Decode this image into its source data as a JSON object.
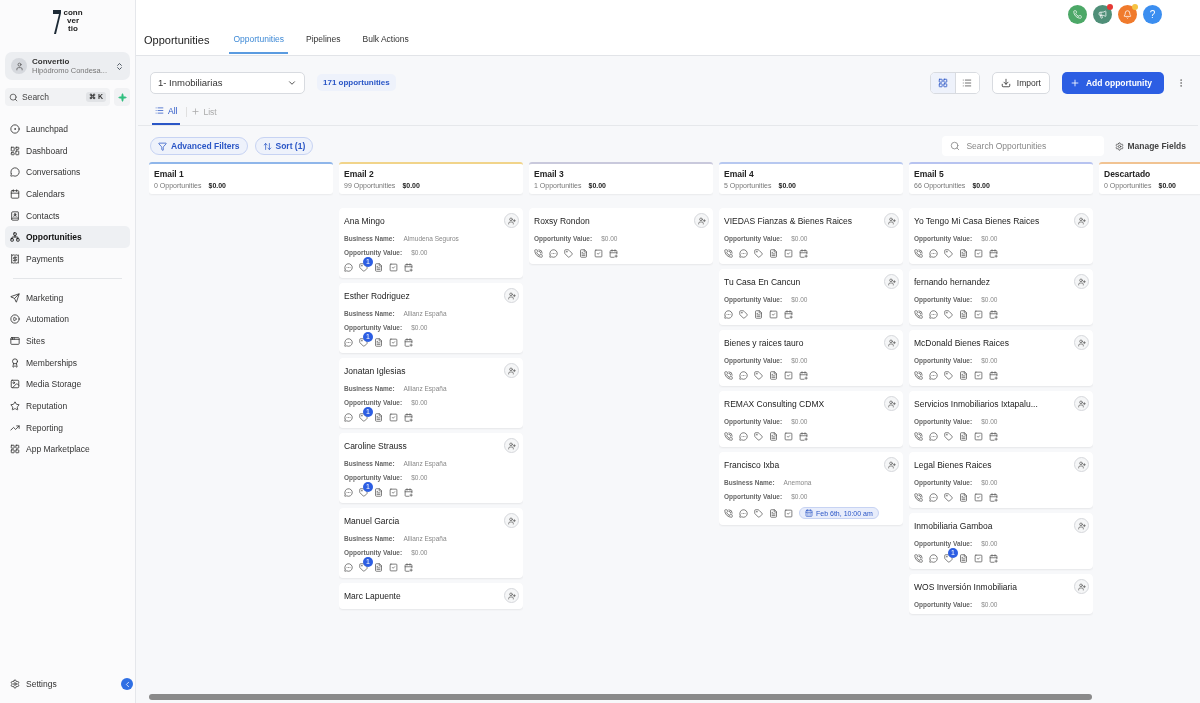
{
  "sidebar": {
    "logo_text": [
      "conn",
      "ver",
      "tio"
    ],
    "account": {
      "name": "Convertio",
      "location": "Hipódromo Condesa..."
    },
    "search": {
      "placeholder": "Search",
      "shortcut": "⌘ K"
    },
    "nav_groups": [
      [
        {
          "label": "Launchpad",
          "selected": false
        },
        {
          "label": "Dashboard",
          "selected": false
        },
        {
          "label": "Conversations",
          "selected": false
        },
        {
          "label": "Calendars",
          "selected": false
        },
        {
          "label": "Contacts",
          "selected": false
        },
        {
          "label": "Opportunities",
          "selected": true
        },
        {
          "label": "Payments",
          "selected": false
        }
      ],
      [
        {
          "label": "Marketing",
          "selected": false
        },
        {
          "label": "Automation",
          "selected": false
        },
        {
          "label": "Sites",
          "selected": false
        },
        {
          "label": "Memberships",
          "selected": false
        },
        {
          "label": "Media Storage",
          "selected": false
        },
        {
          "label": "Reputation",
          "selected": false
        },
        {
          "label": "Reporting",
          "selected": false
        },
        {
          "label": "App Marketplace",
          "selected": false
        }
      ]
    ],
    "settings": "Settings"
  },
  "header": {
    "title": "Opportunities",
    "tabs": [
      {
        "label": "Opportunities",
        "selected": true
      },
      {
        "label": "Pipelines",
        "selected": false
      },
      {
        "label": "Bulk Actions",
        "selected": false
      }
    ],
    "actions": [
      {
        "kind": "phone",
        "color": "#4ca867"
      },
      {
        "kind": "megaphone",
        "color": "#4f8f78",
        "dot": {
          "color": "#e53935"
        }
      },
      {
        "kind": "bell",
        "color": "#f07a2c",
        "dot": {
          "color": "#f5c242"
        }
      },
      {
        "kind": "help",
        "color": "#3b8ef0",
        "label": "?"
      }
    ]
  },
  "toolbar": {
    "pipeline": "1- Inmobiliarias",
    "count": "171 opportunities",
    "views": [
      {
        "kind": "grid",
        "selected": true
      },
      {
        "kind": "list",
        "selected": false
      }
    ],
    "import": "Import",
    "add": "Add opportunity"
  },
  "list_tabs": [
    {
      "label": "All",
      "selected": true
    }
  ],
  "add_list": "List",
  "filters": {
    "advanced": "Advanced Filters",
    "sort": "Sort (1)",
    "search_placeholder": "Search Opportunities",
    "manage": "Manage Fields"
  },
  "columns": [
    {
      "title": "Email 1",
      "count": "0 Opportunities",
      "total": "$0.00",
      "color": "#8fb6ea"
    },
    {
      "title": "Email 2",
      "count": "99 Opportunities",
      "total": "$0.00",
      "color": "#f1d48a",
      "cards": [
        {
          "name": "Ana Mingo",
          "business_label": "Business Name:",
          "business": "Almudena Seguros",
          "value_label": "Opportunity Value:",
          "value": "$0.00",
          "icons": [
            {
              "kind": "chat"
            },
            {
              "kind": "tag",
              "badge": "1"
            },
            {
              "kind": "note"
            },
            {
              "kind": "task"
            },
            {
              "kind": "calendar"
            }
          ]
        },
        {
          "name": "Esther Rodriguez",
          "business_label": "Business Name:",
          "business": "Allianz España",
          "value_label": "Opportunity Value:",
          "value": "$0.00",
          "icons": [
            {
              "kind": "chat"
            },
            {
              "kind": "tag",
              "badge": "1"
            },
            {
              "kind": "note"
            },
            {
              "kind": "task"
            },
            {
              "kind": "calendar"
            }
          ]
        },
        {
          "name": "Jonatan Iglesias",
          "business_label": "Business Name:",
          "business": "Allianz España",
          "value_label": "Opportunity Value:",
          "value": "$0.00",
          "icons": [
            {
              "kind": "chat"
            },
            {
              "kind": "tag",
              "badge": "1"
            },
            {
              "kind": "note"
            },
            {
              "kind": "task"
            },
            {
              "kind": "calendar"
            }
          ]
        },
        {
          "name": "Caroline Strauss",
          "business_label": "Business Name:",
          "business": "Allianz España",
          "value_label": "Opportunity Value:",
          "value": "$0.00",
          "icons": [
            {
              "kind": "chat"
            },
            {
              "kind": "tag",
              "badge": "1"
            },
            {
              "kind": "note"
            },
            {
              "kind": "task"
            },
            {
              "kind": "calendar"
            }
          ]
        },
        {
          "name": "Manuel Garcia",
          "business_label": "Business Name:",
          "business": "Allianz España",
          "value_label": "Opportunity Value:",
          "value": "$0.00",
          "icons": [
            {
              "kind": "chat"
            },
            {
              "kind": "tag",
              "badge": "1"
            },
            {
              "kind": "note"
            },
            {
              "kind": "task"
            },
            {
              "kind": "calendar"
            }
          ]
        },
        {
          "name": "Marc Lapuente"
        }
      ]
    },
    {
      "title": "Email 3",
      "count": "1 Opportunities",
      "total": "$0.00",
      "color": "#c9c9dc",
      "cards": [
        {
          "name": "Roxsy Rondon",
          "value_label": "Opportunity Value:",
          "value": "$0.00",
          "icons": [
            {
              "kind": "phone"
            },
            {
              "kind": "chat"
            },
            {
              "kind": "tag"
            },
            {
              "kind": "note"
            },
            {
              "kind": "task"
            },
            {
              "kind": "calendar"
            }
          ]
        }
      ]
    },
    {
      "title": "Email 4",
      "count": "5 Opportunities",
      "total": "$0.00",
      "color": "#b7c8f0",
      "cards": [
        {
          "name": "VIEDAS Fianzas & Bienes Raices",
          "value_label": "Opportunity Value:",
          "value": "$0.00",
          "icons": [
            {
              "kind": "phone"
            },
            {
              "kind": "chat"
            },
            {
              "kind": "tag"
            },
            {
              "kind": "note"
            },
            {
              "kind": "task"
            },
            {
              "kind": "calendar"
            }
          ]
        },
        {
          "name": "Tu Casa En Cancun",
          "value_label": "Opportunity Value:",
          "value": "$0.00",
          "icons": [
            {
              "kind": "chat"
            },
            {
              "kind": "tag"
            },
            {
              "kind": "note"
            },
            {
              "kind": "task"
            },
            {
              "kind": "calendar"
            }
          ]
        },
        {
          "name": "Bienes y raices tauro",
          "value_label": "Opportunity Value:",
          "value": "$0.00",
          "icons": [
            {
              "kind": "phone"
            },
            {
              "kind": "chat"
            },
            {
              "kind": "tag"
            },
            {
              "kind": "note"
            },
            {
              "kind": "task"
            },
            {
              "kind": "calendar"
            }
          ]
        },
        {
          "name": "REMAX Consulting CDMX",
          "value_label": "Opportunity Value:",
          "value": "$0.00",
          "icons": [
            {
              "kind": "phone"
            },
            {
              "kind": "chat"
            },
            {
              "kind": "tag"
            },
            {
              "kind": "note"
            },
            {
              "kind": "task"
            },
            {
              "kind": "calendar"
            }
          ]
        },
        {
          "name": "Francisco Ixba",
          "business_label": "Business Name:",
          "business": "Anemona",
          "value_label": "Opportunity Value:",
          "value": "$0.00",
          "icons": [
            {
              "kind": "phone"
            },
            {
              "kind": "chat"
            },
            {
              "kind": "tag"
            },
            {
              "kind": "note"
            },
            {
              "kind": "task"
            }
          ],
          "appointment": "Feb 6th, 10:00 am"
        }
      ]
    },
    {
      "title": "Email 5",
      "count": "66 Opportunities",
      "total": "$0.00",
      "color": "#b7c3f0",
      "cards": [
        {
          "name": "Yo Tengo Mi Casa Bienes Raices",
          "value_label": "Opportunity Value:",
          "value": "$0.00",
          "icons": [
            {
              "kind": "phone"
            },
            {
              "kind": "chat"
            },
            {
              "kind": "tag"
            },
            {
              "kind": "note"
            },
            {
              "kind": "task"
            },
            {
              "kind": "calendar"
            }
          ]
        },
        {
          "name": "fernando hernandez",
          "value_label": "Opportunity Value:",
          "value": "$0.00",
          "icons": [
            {
              "kind": "phone"
            },
            {
              "kind": "chat"
            },
            {
              "kind": "tag"
            },
            {
              "kind": "note"
            },
            {
              "kind": "task"
            },
            {
              "kind": "calendar"
            }
          ]
        },
        {
          "name": "McDonald Bienes Raices",
          "value_label": "Opportunity Value:",
          "value": "$0.00",
          "icons": [
            {
              "kind": "phone"
            },
            {
              "kind": "chat"
            },
            {
              "kind": "tag"
            },
            {
              "kind": "note"
            },
            {
              "kind": "task"
            },
            {
              "kind": "calendar"
            }
          ]
        },
        {
          "name": "Servicios Inmobiliarios Ixtapalu...",
          "value_label": "Opportunity Value:",
          "value": "$0.00",
          "icons": [
            {
              "kind": "phone"
            },
            {
              "kind": "chat"
            },
            {
              "kind": "tag"
            },
            {
              "kind": "note"
            },
            {
              "kind": "task"
            },
            {
              "kind": "calendar"
            }
          ]
        },
        {
          "name": "Legal Bienes Raices",
          "value_label": "Opportunity Value:",
          "value": "$0.00",
          "icons": [
            {
              "kind": "phone"
            },
            {
              "kind": "chat"
            },
            {
              "kind": "tag"
            },
            {
              "kind": "note"
            },
            {
              "kind": "task"
            },
            {
              "kind": "calendar"
            }
          ]
        },
        {
          "name": "Inmobiliaria Gamboa",
          "value_label": "Opportunity Value:",
          "value": "$0.00",
          "icons": [
            {
              "kind": "phone"
            },
            {
              "kind": "chat"
            },
            {
              "kind": "tag",
              "badge": "1"
            },
            {
              "kind": "note"
            },
            {
              "kind": "task"
            },
            {
              "kind": "calendar"
            }
          ]
        },
        {
          "name": "WOS Inversión Inmobiliaria",
          "value_label": "Opportunity Value:",
          "value": "$0.00"
        }
      ]
    },
    {
      "title": "Descartado",
      "count": "0 Opportunities",
      "total": "$0.00",
      "color": "#f1c392"
    }
  ]
}
